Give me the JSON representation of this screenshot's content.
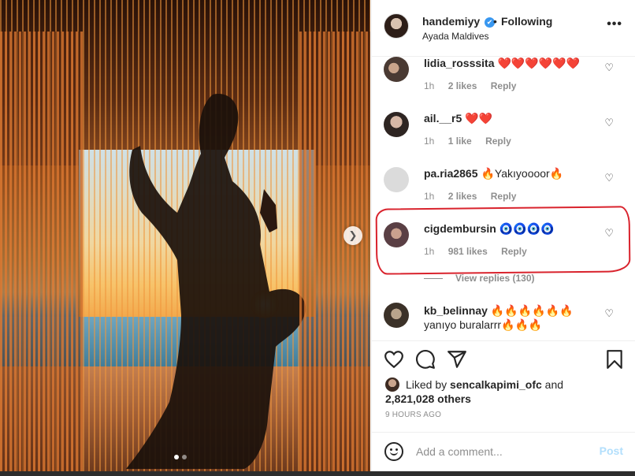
{
  "post": {
    "username": "handemiyy",
    "verified_mark": "✔",
    "separator": "•",
    "follow_status": "Following",
    "location": "Ayada Maldives",
    "more_label": "•••"
  },
  "comments": [
    {
      "user": "lidia_rosssita",
      "text": "❤️❤️❤️❤️❤️❤️",
      "time": "1h",
      "likes": "2 likes",
      "reply": "Reply"
    },
    {
      "user": "ail.__r5",
      "text": "❤️❤️",
      "time": "1h",
      "likes": "1 like",
      "reply": "Reply"
    },
    {
      "user": "pa.ria2865",
      "text": "🔥Yakıyoooor🔥",
      "time": "1h",
      "likes": "2 likes",
      "reply": "Reply"
    },
    {
      "user": "cigdembursin",
      "text": "🧿🧿🧿🧿",
      "time": "1h",
      "likes": "981 likes",
      "reply": "Reply"
    },
    {
      "user": "kb_belinnay",
      "text": "🔥🔥🔥🔥🔥🔥yanıyo buralarrr🔥🔥🔥",
      "time": "",
      "likes": "",
      "reply": ""
    }
  ],
  "view_replies": "View replies (130)",
  "likes": {
    "prefix": "Liked by",
    "user": "sencalkapimi_ofc",
    "and": "and",
    "others": "2,821,028 others"
  },
  "timestamp": "9 HOURS AGO",
  "composer": {
    "placeholder": "Add a comment...",
    "post_label": "Post"
  },
  "icons": {
    "header_more": "more-icon",
    "verified": "verified-badge-icon",
    "like": "heart-icon",
    "comment": "comment-icon",
    "share": "share-icon",
    "save": "bookmark-icon",
    "emoji": "emoji-icon",
    "carousel_next": "chevron-right-icon"
  },
  "colors": {
    "link_blue": "#3897f0",
    "post_disabled": "#b2dffc",
    "annotation_red": "#d9232d",
    "muted_text": "#8e8e8e"
  },
  "carousel": {
    "next_glyph": "❯",
    "slides": 2,
    "active": 1
  }
}
